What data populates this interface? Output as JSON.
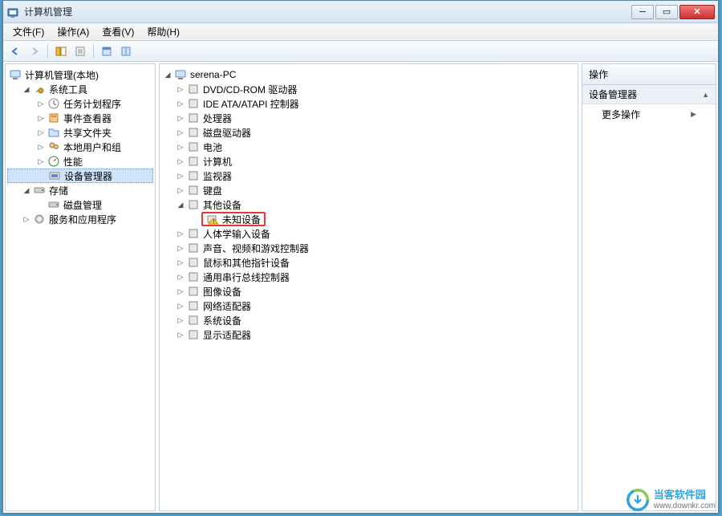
{
  "window": {
    "title": "计算机管理"
  },
  "menubar": [
    "文件(F)",
    "操作(A)",
    "查看(V)",
    "帮助(H)"
  ],
  "left_tree": {
    "root": "计算机管理(本地)",
    "groups": [
      {
        "label": "系统工具",
        "children": [
          "任务计划程序",
          "事件查看器",
          "共享文件夹",
          "本地用户和组",
          "性能",
          "设备管理器"
        ],
        "selected": "设备管理器"
      },
      {
        "label": "存储",
        "children": [
          "磁盘管理"
        ]
      },
      {
        "label": "服务和应用程序",
        "children": []
      }
    ]
  },
  "center_tree": {
    "root": "serena-PC",
    "items": [
      {
        "label": "DVD/CD-ROM 驱动器",
        "expand": "right"
      },
      {
        "label": "IDE ATA/ATAPI 控制器",
        "expand": "right"
      },
      {
        "label": "处理器",
        "expand": "right"
      },
      {
        "label": "磁盘驱动器",
        "expand": "right"
      },
      {
        "label": "电池",
        "expand": "right"
      },
      {
        "label": "计算机",
        "expand": "right"
      },
      {
        "label": "监视器",
        "expand": "right"
      },
      {
        "label": "键盘",
        "expand": "right"
      },
      {
        "label": "其他设备",
        "expand": "down",
        "children": [
          {
            "label": "未知设备",
            "highlight": true
          }
        ]
      },
      {
        "label": "人体学输入设备",
        "expand": "right"
      },
      {
        "label": "声音、视频和游戏控制器",
        "expand": "right"
      },
      {
        "label": "鼠标和其他指针设备",
        "expand": "right"
      },
      {
        "label": "通用串行总线控制器",
        "expand": "right"
      },
      {
        "label": "图像设备",
        "expand": "right"
      },
      {
        "label": "网络适配器",
        "expand": "right"
      },
      {
        "label": "系统设备",
        "expand": "right"
      },
      {
        "label": "显示适配器",
        "expand": "right"
      }
    ]
  },
  "right_panel": {
    "header": "操作",
    "section": "设备管理器",
    "item": "更多操作"
  },
  "watermark": {
    "name": "当客软件园",
    "url": "www.downkr.com"
  }
}
